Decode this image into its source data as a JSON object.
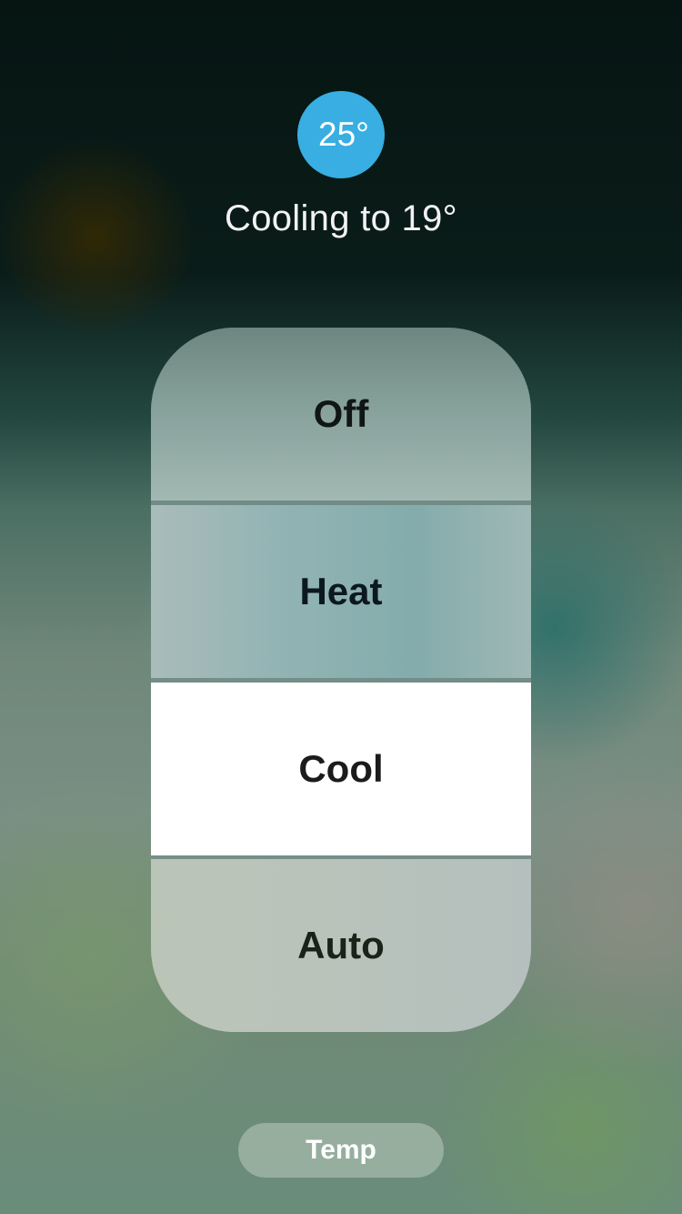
{
  "thermostat": {
    "current_temperature": "25°",
    "status_text": "Cooling to 19°",
    "indicator_color": "#38aee2"
  },
  "mode_selector": {
    "selected": "Cool",
    "options": [
      {
        "label": "Off",
        "selected": false
      },
      {
        "label": "Heat",
        "selected": false
      },
      {
        "label": "Cool",
        "selected": true
      },
      {
        "label": "Auto",
        "selected": false
      }
    ]
  },
  "footer": {
    "temp_button_label": "Temp"
  }
}
